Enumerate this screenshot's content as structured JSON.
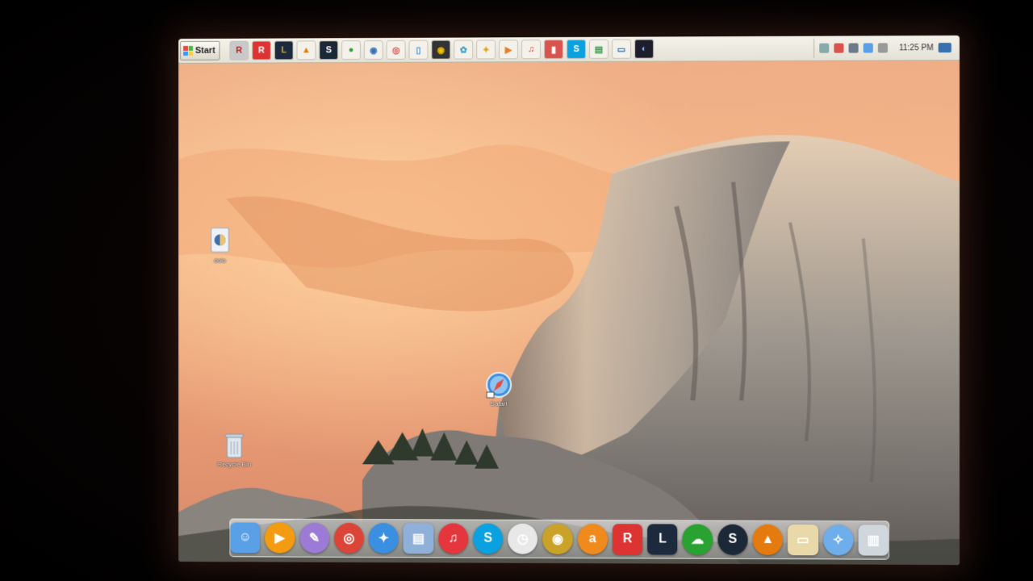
{
  "taskbar": {
    "start_label": "Start",
    "clock": "11:25 PM",
    "quick_launch": [
      {
        "name": "roblox-studio-icon",
        "glyph": "R",
        "color": "#c9c9c9",
        "fg": "#b22"
      },
      {
        "name": "roblox-icon",
        "glyph": "R",
        "color": "#d33",
        "fg": "#fff"
      },
      {
        "name": "league-of-legends-icon",
        "glyph": "L",
        "color": "#1d2a3d",
        "fg": "#c9a54b"
      },
      {
        "name": "vlc-cone-icon",
        "glyph": "▲",
        "color": "#f3f1ea",
        "fg": "#e57b0e"
      },
      {
        "name": "steam-icon",
        "glyph": "S",
        "color": "#1b2838",
        "fg": "#fff"
      },
      {
        "name": "green-cloud-icon",
        "glyph": "●",
        "color": "#f3f1ea",
        "fg": "#2aa232"
      },
      {
        "name": "globe-icon",
        "glyph": "◉",
        "color": "#f3f1ea",
        "fg": "#2f6fb5"
      },
      {
        "name": "chrome-icon",
        "glyph": "◎",
        "color": "#f3f1ea",
        "fg": "#db4437"
      },
      {
        "name": "phone-icon",
        "glyph": "▯",
        "color": "#f3f1ea",
        "fg": "#4a90d9"
      },
      {
        "name": "media-player-icon",
        "glyph": "◉",
        "color": "#333",
        "fg": "#f2c200"
      },
      {
        "name": "paint-icon",
        "glyph": "✿",
        "color": "#f3f1ea",
        "fg": "#3aa0c8"
      },
      {
        "name": "photos-icon",
        "glyph": "✦",
        "color": "#f3f1ea",
        "fg": "#e3a21a"
      },
      {
        "name": "player-icon",
        "glyph": "▶",
        "color": "#f3f1ea",
        "fg": "#e67e22"
      },
      {
        "name": "itunes-icon",
        "glyph": "♫",
        "color": "#f3f1ea",
        "fg": "#e4363c"
      },
      {
        "name": "book-icon",
        "glyph": "▮",
        "color": "#d9534f",
        "fg": "#fff"
      },
      {
        "name": "skype-icon",
        "glyph": "S",
        "color": "#0aa1e0",
        "fg": "#fff"
      },
      {
        "name": "file-manager-icon",
        "glyph": "▤",
        "color": "#f3f1ea",
        "fg": "#3a9b4a"
      },
      {
        "name": "monitor-icon",
        "glyph": "▭",
        "color": "#f3f1ea",
        "fg": "#2f6fb5"
      },
      {
        "name": "dashboard-icon",
        "glyph": "◐",
        "color": "#1d1d2b",
        "fg": "#7ab8ff"
      }
    ]
  },
  "desktop": {
    "icons": [
      {
        "label": "dolo",
        "name": "desktop-icon-dolo"
      },
      {
        "label": "Safari",
        "name": "desktop-icon-safari"
      },
      {
        "label": "Recycle Bin",
        "name": "desktop-icon-recycle-bin"
      }
    ]
  },
  "dock": {
    "items": [
      {
        "name": "finder-icon",
        "glyph": "☺",
        "color": "#5aa0e6"
      },
      {
        "name": "quicktime-icon",
        "glyph": "▶",
        "color": "#f39c12"
      },
      {
        "name": "paintbrush-icon",
        "glyph": "✎",
        "color": "#9b7bd6"
      },
      {
        "name": "chrome-icon",
        "glyph": "◎",
        "color": "#db4437"
      },
      {
        "name": "safari-icon",
        "glyph": "✦",
        "color": "#3b8fe0"
      },
      {
        "name": "notes-icon",
        "glyph": "▤",
        "color": "#8fb0d8"
      },
      {
        "name": "itunes-icon",
        "glyph": "♫",
        "color": "#e4363c"
      },
      {
        "name": "skype-icon",
        "glyph": "S",
        "color": "#0aa1e0"
      },
      {
        "name": "clock-icon",
        "glyph": "◷",
        "color": "#e8e8e8"
      },
      {
        "name": "dvd-player-icon",
        "glyph": "◉",
        "color": "#c9a227"
      },
      {
        "name": "avast-icon",
        "glyph": "a",
        "color": "#f18a1c"
      },
      {
        "name": "roblox-icon",
        "glyph": "R",
        "color": "#d33"
      },
      {
        "name": "league-of-legends-icon",
        "glyph": "L",
        "color": "#1d2a3d"
      },
      {
        "name": "cloud-icon",
        "glyph": "☁",
        "color": "#2aa232"
      },
      {
        "name": "steam-icon",
        "glyph": "S",
        "color": "#1b2838"
      },
      {
        "name": "vlc-icon",
        "glyph": "▲",
        "color": "#e57b0e"
      },
      {
        "name": "folder-icon",
        "glyph": "▭",
        "color": "#e9d9a8"
      },
      {
        "name": "compass-icon",
        "glyph": "✧",
        "color": "#6eaeea"
      },
      {
        "name": "trash-icon",
        "glyph": "▥",
        "color": "#cfd6dc"
      }
    ]
  },
  "colors": {
    "sky_top": "#f2b48c",
    "sky_mid": "#e9a37a",
    "rock_light": "#d9cbbf",
    "rock_dark": "#4d4a47"
  }
}
